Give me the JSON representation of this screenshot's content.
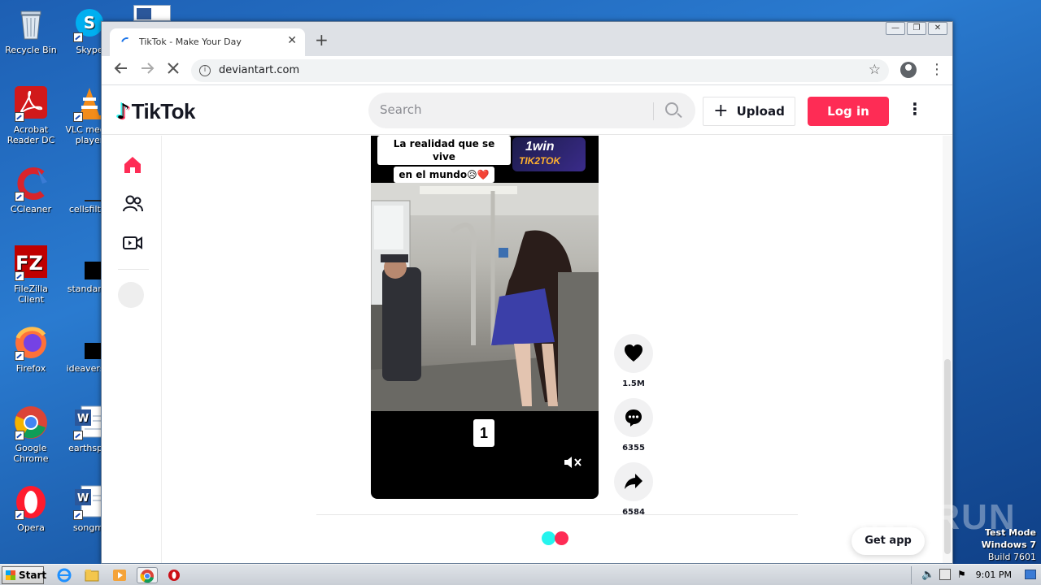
{
  "desktop": {
    "icons": [
      {
        "label": "Recycle Bin",
        "icon": "recycle-bin-icon"
      },
      {
        "label": "Skype",
        "icon": "skype-icon"
      },
      {
        "label": "Acrobat Reader DC",
        "icon": "acrobat-icon"
      },
      {
        "label": "VLC media player",
        "icon": "vlc-icon"
      },
      {
        "label": "CCleaner",
        "icon": "ccleaner-icon"
      },
      {
        "label": "cellsfilter",
        "icon": "file-icon"
      },
      {
        "label": "FileZilla Client",
        "icon": "filezilla-icon"
      },
      {
        "label": "standards",
        "icon": "file-icon"
      },
      {
        "label": "Firefox",
        "icon": "firefox-icon"
      },
      {
        "label": "ideaversio",
        "icon": "file-icon"
      },
      {
        "label": "Google Chrome",
        "icon": "chrome-icon"
      },
      {
        "label": "earthspai",
        "icon": "word-doc-icon"
      },
      {
        "label": "Opera",
        "icon": "opera-icon"
      },
      {
        "label": "songmi",
        "icon": "word-doc-icon"
      }
    ],
    "watermark": "ANY RUN",
    "test_mode": [
      "Test Mode",
      "Windows 7",
      "Build 7601"
    ]
  },
  "browser": {
    "tab_title": "TikTok - Make Your Day",
    "tab_close": "✕",
    "new_tab": "+",
    "url": "deviantart.com",
    "window_controls": [
      "—",
      "❐",
      "✕"
    ]
  },
  "tiktok": {
    "logo_text": "TikTok",
    "search_placeholder": "Search",
    "upload_label": "Upload",
    "login_label": "Log in",
    "video": {
      "caption_line1": "La realidad que se vive",
      "caption_line2": "en el mundo😥❤️",
      "badge_top": "1win",
      "badge_bottom": "TIK2TOK",
      "counter": "1"
    },
    "actions": [
      {
        "name": "like",
        "icon": "heart-icon",
        "count": "1.5M"
      },
      {
        "name": "comment",
        "icon": "comment-icon",
        "count": "6355"
      },
      {
        "name": "share",
        "icon": "share-icon",
        "count": "6584"
      }
    ],
    "get_app_label": "Get app",
    "colors": {
      "brand_pink": "#fe2c55",
      "brand_cyan": "#25f4ee"
    }
  },
  "taskbar": {
    "start_label": "Start",
    "clock": "9:01 PM"
  }
}
